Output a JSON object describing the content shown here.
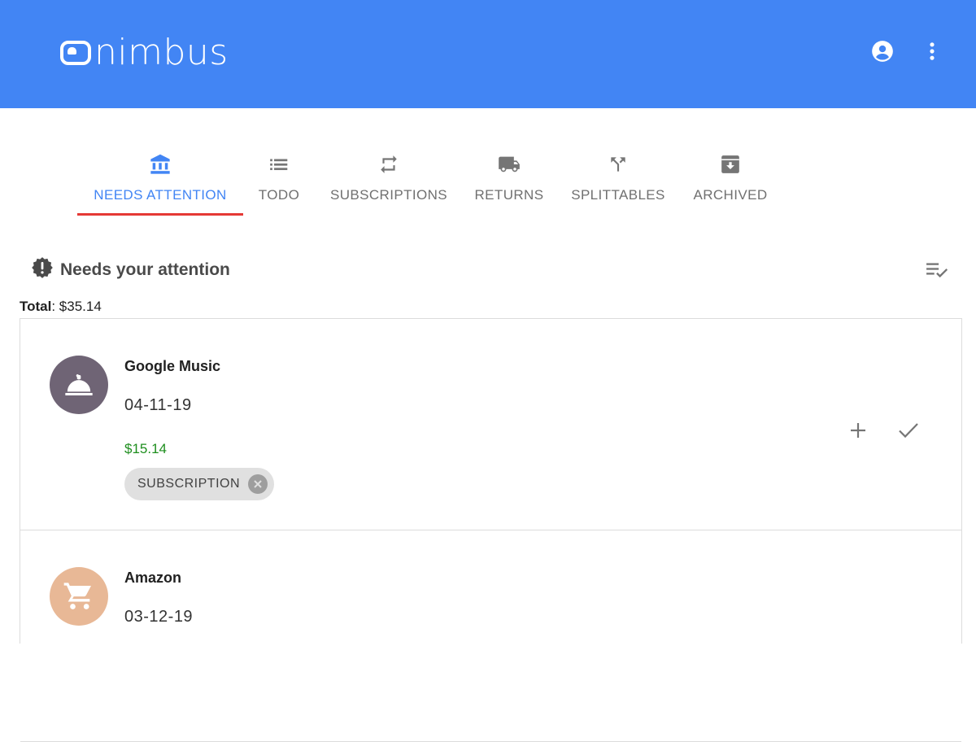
{
  "app": {
    "name": "nimbus",
    "brand_color": "#4285f4",
    "icons": {
      "account": "account-circle-icon",
      "menu": "more-vert-icon"
    }
  },
  "tabs": [
    {
      "label": "NEEDS ATTENTION",
      "icon": "bank-icon",
      "active": true
    },
    {
      "label": "TODO",
      "icon": "list-icon",
      "active": false
    },
    {
      "label": "SUBSCRIPTIONS",
      "icon": "repeat-icon",
      "active": false
    },
    {
      "label": "RETURNS",
      "icon": "truck-icon",
      "active": false
    },
    {
      "label": "SPLITTABLES",
      "icon": "call-split-icon",
      "active": false
    },
    {
      "label": "ARCHIVED",
      "icon": "archive-icon",
      "active": false
    }
  ],
  "section": {
    "title": "Needs your attention",
    "icon": "alert-badge-icon",
    "sort_icon": "playlist-check-icon",
    "total_label": "Total",
    "total_value": ": $35.14"
  },
  "transactions": [
    {
      "merchant": "Google Music",
      "date": "04-11-19",
      "amount": "$15.14",
      "avatar_icon": "room-service-icon",
      "avatar_color": "#6f6475",
      "tag": "SUBSCRIPTION"
    },
    {
      "merchant": "Amazon",
      "date": "03-12-19",
      "avatar_icon": "shopping-cart-icon",
      "avatar_color": "#e8b896"
    }
  ]
}
